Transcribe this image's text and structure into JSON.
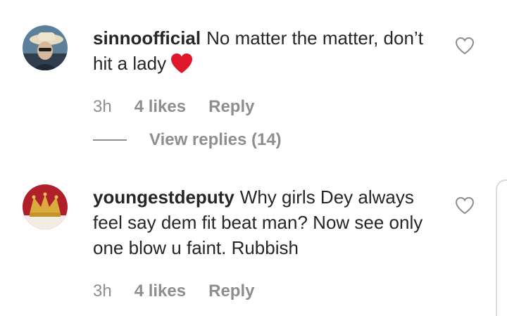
{
  "comments": [
    {
      "username": "sinnoofficial",
      "text": "No matter the matter, don’t hit a lady",
      "emoji": "red-heart",
      "time": "3h",
      "likes": "4 likes",
      "reply": "Reply",
      "view_replies": "View replies (14)"
    },
    {
      "username": "youngestdeputy",
      "text": "Why girls Dey always feel say dem fit beat man? Now see only one blow u faint. Rubbish",
      "time": "3h",
      "likes": "4 likes",
      "reply": "Reply"
    }
  ],
  "icons": {
    "like": "heart-outline-icon",
    "emoji": "red-heart-icon"
  },
  "colors": {
    "text": "#262626",
    "muted": "#8e8e8e",
    "heart": "#e0162b"
  }
}
